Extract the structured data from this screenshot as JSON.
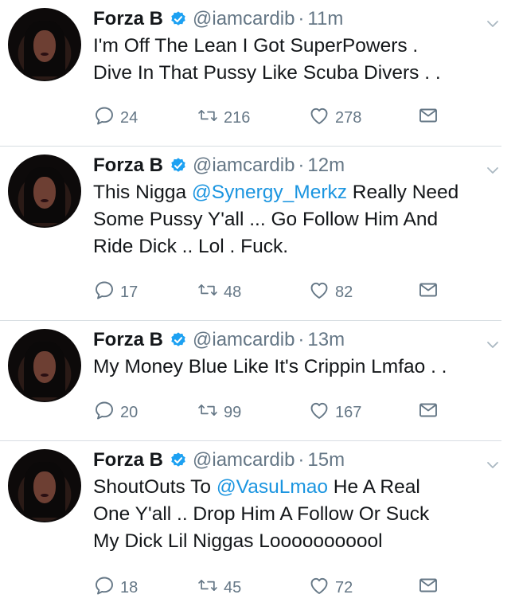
{
  "tweets": [
    {
      "name": "Forza B",
      "handle": "@iamcardib",
      "sep": "·",
      "time": "11m",
      "lines": [
        [
          {
            "t": "I'm Off The Lean I Got SuperPowers ."
          }
        ],
        [
          {
            "t": "Dive In That Pussy Like Scuba Divers . ."
          }
        ]
      ],
      "replies": "24",
      "retweets": "216",
      "likes": "278"
    },
    {
      "name": "Forza B",
      "handle": "@iamcardib",
      "sep": "·",
      "time": "12m",
      "lines": [
        [
          {
            "t": "This Nigga "
          },
          {
            "t": "@Synergy_Merkz",
            "mention": true
          },
          {
            "t": " Really Need"
          }
        ],
        [
          {
            "t": "Some Pussy Y'all ... Go Follow Him And"
          }
        ],
        [
          {
            "t": "Ride Dick .. Lol . Fuck."
          }
        ]
      ],
      "replies": "17",
      "retweets": "48",
      "likes": "82"
    },
    {
      "name": "Forza B",
      "handle": "@iamcardib",
      "sep": "·",
      "time": "13m",
      "lines": [
        [
          {
            "t": "My Money Blue Like It's Crippin Lmfao . ."
          }
        ]
      ],
      "replies": "20",
      "retweets": "99",
      "likes": "167"
    },
    {
      "name": "Forza B",
      "handle": "@iamcardib",
      "sep": "·",
      "time": "15m",
      "lines": [
        [
          {
            "t": "ShoutOuts To "
          },
          {
            "t": "@VasuLmao",
            "mention": true
          },
          {
            "t": " He A Real"
          }
        ],
        [
          {
            "t": "One Y'all .. Drop Him A Follow Or Suck"
          }
        ],
        [
          {
            "t": "My Dick Lil Niggas Looooooooool"
          }
        ]
      ],
      "replies": "18",
      "retweets": "45",
      "likes": "72"
    }
  ],
  "colors": {
    "accent": "#1b95e0",
    "muted": "#657786",
    "text": "#14171a",
    "verified": "#1da1f2",
    "divider": "#d7dde2"
  },
  "icons": {
    "verified": "verified-badge-icon",
    "menu": "chevron-down-icon",
    "reply": "reply-icon",
    "retweet": "retweet-icon",
    "like": "heart-icon",
    "dm": "direct-message-icon"
  }
}
